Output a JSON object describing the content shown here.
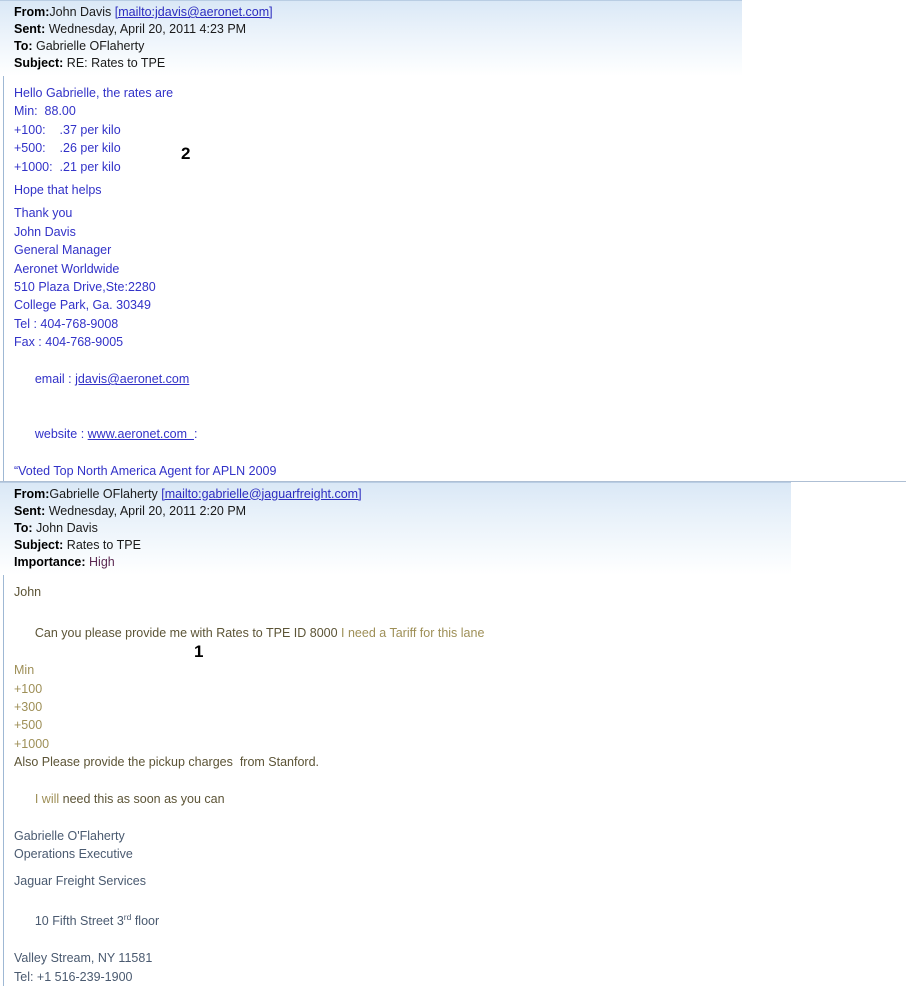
{
  "messages": [
    {
      "id": "reply-message",
      "header": {
        "from_label": "From:",
        "from_value": "John Davis ",
        "from_link": "[mailto:jdavis@aeronet.com]",
        "sent_label": "Sent:",
        "sent_value": "Wednesday, April 20, 2011 4:23 PM",
        "to_label": "To:",
        "to_value": "Gabrielle OFlaherty",
        "subject_label": "Subject:",
        "subject_value": "RE: Rates to TPE"
      },
      "body": {
        "greeting": "Hello Gabrielle, the rates are",
        "rate_lines": [
          "Min:  88.00",
          "+100:    .37 per kilo",
          "+500:    .26 per kilo",
          "+1000:  .21 per kilo"
        ],
        "closing": "Hope that helps",
        "thanks": "Thank you",
        "signature": [
          "John Davis",
          "General Manager",
          "Aeronet Worldwide",
          "510 Plaza Drive,Ste:2280",
          "College Park, Ga. 30349",
          "Tel : 404-768-9008",
          "Fax : 404-768-9005"
        ],
        "email_label": "email : ",
        "email_link": "jdavis@aeronet.com",
        "website_label": "website : ",
        "website_link": "www.aeronet.com  ",
        "website_suffix": ":",
        "tagline": "“Voted Top North America Agent for APLN 2009"
      }
    },
    {
      "id": "original-message",
      "header": {
        "from_label": "From:",
        "from_value": "Gabrielle OFlaherty ",
        "from_link": "[mailto:gabrielle@jaguarfreight.com]",
        "sent_label": "Sent:",
        "sent_value": "Wednesday, April 20, 2011 2:20 PM",
        "to_label": "To:",
        "to_value": "John Davis",
        "subject_label": "Subject:",
        "subject_value": "Rates to TPE",
        "importance_label": "Importance:",
        "importance_value": "High"
      },
      "body": {
        "salutation": "John",
        "request_part1": "Can you please provide me with Rates to TPE ID 8000 ",
        "request_part2": "I need a Tariff for this lane",
        "break_lines": [
          "Min",
          "+100",
          "+300",
          "+500",
          "+1000"
        ],
        "pickup_request": "Also Please provide the pickup charges  from Stanford.",
        "urgency_part1": "I will",
        "urgency_part2": " need this as soon as you can",
        "signer_name": "Gabrielle O'Flaherty",
        "signer_title": "Operations Executive",
        "company": "Jaguar Freight Services",
        "address_line_pre": "10 Fifth Street 3",
        "address_line_sup": "rd",
        "address_line_post": " floor",
        "city_state_zip": "Valley Stream, NY 11581",
        "telephone": "Tel: +1 516-239-1900"
      }
    }
  ],
  "annotations": [
    {
      "label": "2"
    },
    {
      "label": "1"
    }
  ]
}
